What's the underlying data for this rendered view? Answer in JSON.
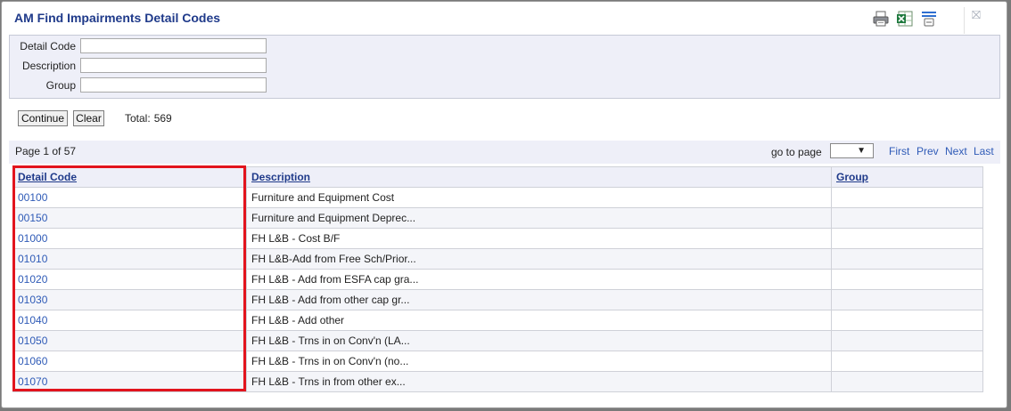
{
  "dialog": {
    "title": "AM Find Impairments Detail Codes",
    "close_symbol": "⛝"
  },
  "search": {
    "fields": [
      {
        "label": "Detail Code",
        "value": "",
        "placeholder": ""
      },
      {
        "label": "Description",
        "value": "",
        "placeholder": ""
      },
      {
        "label": "Group",
        "value": "",
        "placeholder": ""
      }
    ]
  },
  "actions": {
    "continue_label": "Continue",
    "clear_label": "Clear",
    "total_label": "Total:",
    "total_value": "569"
  },
  "pager": {
    "page_info": "Page 1 of 57",
    "goto_label": "go to page",
    "goto_value": "",
    "first": "First",
    "prev": "Prev",
    "next": "Next",
    "last": "Last"
  },
  "table": {
    "headers": [
      "Detail Code",
      "Description",
      "Group"
    ],
    "rows": [
      {
        "code": "00100",
        "description": "Furniture and Equipment Cost",
        "group": ""
      },
      {
        "code": "00150",
        "description": "Furniture and Equipment Deprec...",
        "group": ""
      },
      {
        "code": "01000",
        "description": "FH L&B - Cost B/F",
        "group": ""
      },
      {
        "code": "01010",
        "description": "FH L&B-Add from Free Sch/Prior...",
        "group": ""
      },
      {
        "code": "01020",
        "description": "FH L&B - Add from ESFA cap gra...",
        "group": ""
      },
      {
        "code": "01030",
        "description": "FH L&B - Add from other cap gr...",
        "group": ""
      },
      {
        "code": "01040",
        "description": "FH L&B - Add other",
        "group": ""
      },
      {
        "code": "01050",
        "description": "FH L&B - Trns in on Conv'n (LA...",
        "group": ""
      },
      {
        "code": "01060",
        "description": "FH L&B - Trns in on Conv'n (no...",
        "group": ""
      },
      {
        "code": "01070",
        "description": "FH L&B - Trns in from other ex...",
        "group": ""
      }
    ]
  },
  "colors": {
    "title": "#1f3a8a",
    "link": "#2f5bb7",
    "panel_bg": "#eeeff8",
    "highlight": "#e2141d"
  }
}
